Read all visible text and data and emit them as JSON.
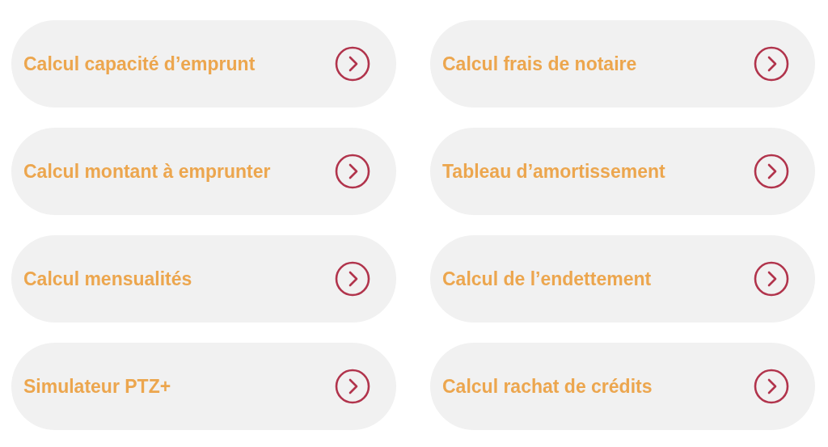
{
  "links": [
    {
      "label": "Calcul capacité d’emprunt"
    },
    {
      "label": "Calcul frais de notaire"
    },
    {
      "label": "Calcul montant à emprunter"
    },
    {
      "label": "Tableau d’amortissement"
    },
    {
      "label": "Calcul mensualités"
    },
    {
      "label": "Calcul de l’endettement"
    },
    {
      "label": "Simulateur PTZ+"
    },
    {
      "label": "Calcul rachat de crédits"
    }
  ]
}
